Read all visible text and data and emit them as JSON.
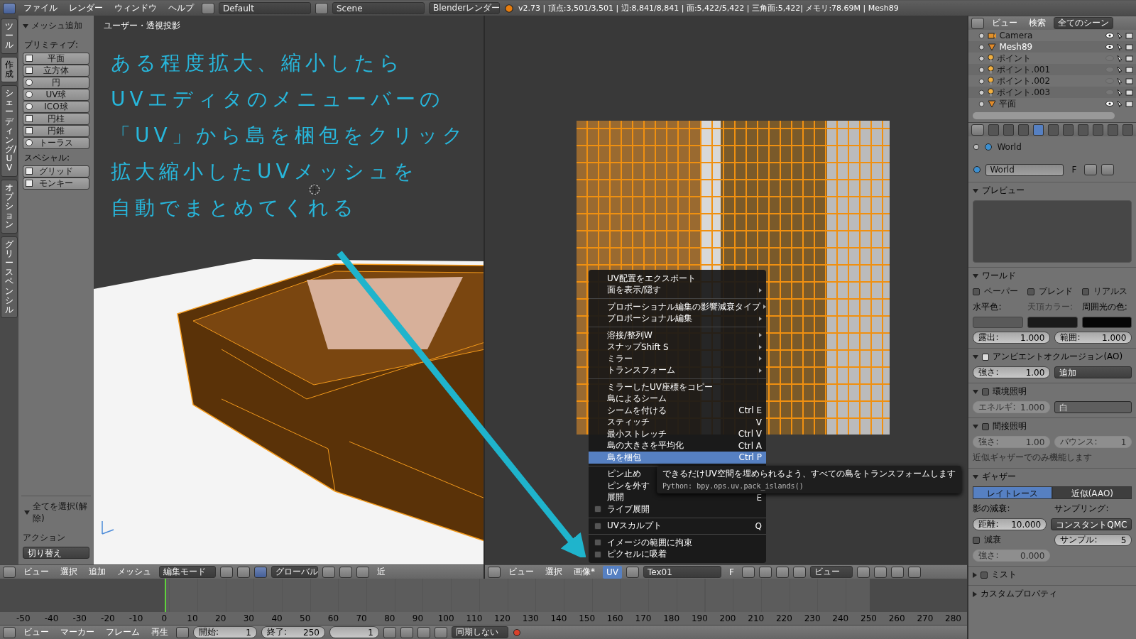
{
  "top_bar": {
    "menus": [
      "ファイル",
      "レンダー",
      "ウィンドウ",
      "ヘルプ"
    ],
    "screen_layout": "Default",
    "scene": "Scene",
    "render_engine": "Blenderレンダー",
    "stats": "v2.73 | 頂点:3,501/3,501 | 辺:8,841/8,841 | 面:5,422/5,422 | 三角面:5,422| メモリ:78.69M | Mesh89"
  },
  "tool_tabs": [
    {
      "label": "ツール",
      "selected": false
    },
    {
      "label": "作成",
      "selected": true
    },
    {
      "label": "シェーディング/UV",
      "selected": false
    },
    {
      "label": "オプション",
      "selected": false
    },
    {
      "label": "グリースペンシル",
      "selected": false
    }
  ],
  "tool_shelf": {
    "title": "メッシュ追加",
    "sections": [
      {
        "label": "プリミティブ:",
        "buttons": [
          {
            "label": "平面",
            "kind": "square"
          },
          {
            "label": "立方体",
            "kind": "square"
          },
          {
            "label": "円",
            "kind": "round"
          },
          {
            "label": "UV球",
            "kind": "round"
          },
          {
            "label": "ICO球",
            "kind": "round"
          },
          {
            "label": "円柱",
            "kind": "square"
          },
          {
            "label": "円錐",
            "kind": "square"
          },
          {
            "label": "トーラス",
            "kind": "round"
          }
        ]
      },
      {
        "label": "スペシャル:",
        "buttons": [
          {
            "label": "グリッド",
            "kind": "square"
          },
          {
            "label": "モンキー",
            "kind": "square"
          }
        ]
      }
    ]
  },
  "operator_panel": {
    "title": "全てを選択(解除)",
    "action_label": "アクション",
    "action_value": "切り替え"
  },
  "viewport": {
    "label": "ユーザー・透視投影",
    "annotation": [
      "ある程度拡大、縮小したら",
      "UVエディタのメニューバーの",
      "「UV」から島を梱包をクリック",
      "拡大縮小したUVメッシュを",
      "自動でまとめてくれる"
    ]
  },
  "viewport_header": {
    "menus": [
      "ビュー",
      "選択",
      "追加",
      "メッシュ"
    ],
    "mode": "編集モード",
    "orientation": "グローバル",
    "clipped": "近"
  },
  "uv_menu": {
    "groups": [
      [
        {
          "kind": "command",
          "label": "UV配置をエクスポート",
          "submenu": false,
          "selected": false
        },
        {
          "kind": "command",
          "label": "面を表示/隠す",
          "submenu": true,
          "selected": false
        }
      ],
      [
        {
          "kind": "command",
          "label": "プロポーショナル編集の影響減衰タイプ",
          "submenu": true,
          "selected": false
        },
        {
          "kind": "command",
          "label": "プロポーショナル編集",
          "submenu": true,
          "selected": false
        }
      ],
      [
        {
          "kind": "command",
          "label": "溶接/整列",
          "shortcut": "W",
          "submenu": true,
          "selected": false
        },
        {
          "kind": "command",
          "label": "スナップ",
          "shortcut": "Shift S",
          "submenu": true,
          "selected": false
        },
        {
          "kind": "command",
          "label": "ミラー",
          "submenu": true,
          "selected": false
        },
        {
          "kind": "command",
          "label": "トランスフォーム",
          "submenu": true,
          "selected": false
        }
      ],
      [
        {
          "kind": "command",
          "label": "ミラーしたUV座標をコピー",
          "submenu": false,
          "selected": false
        },
        {
          "kind": "command",
          "label": "島によるシーム",
          "submenu": false,
          "selected": false
        },
        {
          "kind": "command",
          "label": "シームを付ける",
          "shortcut": "Ctrl E",
          "submenu": false,
          "selected": false
        },
        {
          "kind": "command",
          "label": "スティッチ",
          "shortcut": "V",
          "submenu": false,
          "selected": false
        },
        {
          "kind": "command",
          "label": "最小ストレッチ",
          "shortcut": "Ctrl V",
          "submenu": false,
          "selected": false
        },
        {
          "kind": "command",
          "label": "島の大きさを平均化",
          "shortcut": "Ctrl A",
          "submenu": false,
          "selected": false
        },
        {
          "kind": "command",
          "label": "島を梱包",
          "shortcut": "Ctrl P",
          "submenu": false,
          "selected": true
        }
      ],
      [
        {
          "kind": "command",
          "label": "ピン止め",
          "submenu": false,
          "selected": false
        },
        {
          "kind": "command",
          "label": "ピンを外す",
          "submenu": false,
          "selected": false
        },
        {
          "kind": "command",
          "label": "展開",
          "shortcut": "E",
          "submenu": false,
          "selected": false
        },
        {
          "kind": "toggle",
          "label": "ライブ展開",
          "checked": false,
          "submenu": false,
          "selected": false
        }
      ],
      [
        {
          "kind": "toggle",
          "label": "UVスカルプト",
          "shortcut": "Q",
          "checked": false,
          "submenu": false,
          "selected": false
        }
      ],
      [
        {
          "kind": "toggle",
          "label": "イメージの範囲に拘束",
          "checked": false,
          "submenu": false,
          "selected": false
        },
        {
          "kind": "toggle",
          "label": "ピクセルに吸着",
          "checked": false,
          "submenu": false,
          "selected": false
        }
      ]
    ]
  },
  "tooltip": {
    "text": "できるだけUV空間を埋められるよう、すべての島をトランスフォームします",
    "python": "Python: bpy.ops.uv.pack_islands()"
  },
  "uv_header": {
    "menus": [
      {
        "label": "ビュー",
        "selected": false
      },
      {
        "label": "選択",
        "selected": false
      },
      {
        "label": "画像*",
        "selected": false
      },
      {
        "label": "UV",
        "selected": true
      }
    ],
    "image": "Tex01",
    "fake_user": "F",
    "view": "ビュー"
  },
  "timeline": {
    "ticks": [
      "-50",
      "-40",
      "-30",
      "-20",
      "-10",
      "0",
      "10",
      "20",
      "30",
      "40",
      "50",
      "60",
      "70",
      "80",
      "90",
      "100",
      "110",
      "120",
      "130",
      "140",
      "150",
      "160",
      "170",
      "180",
      "190",
      "200",
      "210",
      "220",
      "230",
      "240",
      "250",
      "260",
      "270",
      "280"
    ]
  },
  "timeline_header": {
    "menus": [
      "ビュー",
      "マーカー",
      "フレーム",
      "再生"
    ],
    "start_label": "開始:",
    "start": "1",
    "end_label": "終了:",
    "end": "250",
    "current": "1",
    "sync": "同期しない"
  },
  "outliner": {
    "view": "ビュー",
    "search": "検索",
    "filter": "全てのシーン",
    "items": [
      {
        "name": "Camera",
        "kind": "camera",
        "selected": false,
        "visible": true
      },
      {
        "name": "Mesh89",
        "kind": "mesh",
        "selected": true,
        "visible": true
      },
      {
        "name": "ポイント",
        "kind": "lamp",
        "selected": false,
        "visible": false
      },
      {
        "name": "ポイント.001",
        "kind": "lamp",
        "selected": false,
        "visible": false
      },
      {
        "name": "ポイント.002",
        "kind": "lamp",
        "selected": false,
        "visible": false
      },
      {
        "name": "ポイント.003",
        "kind": "lamp",
        "selected": false,
        "visible": false
      },
      {
        "name": "平面",
        "kind": "mesh",
        "selected": false,
        "visible": true
      }
    ]
  },
  "properties": {
    "tabs": [
      {
        "selected": false
      },
      {
        "selected": false
      },
      {
        "selected": false
      },
      {
        "selected": true
      },
      {
        "selected": false
      },
      {
        "selected": false
      },
      {
        "selected": false
      },
      {
        "selected": false
      },
      {
        "selected": false
      },
      {
        "selected": false
      }
    ],
    "breadcrumb": "World",
    "world_name": "World",
    "fake_user": "F",
    "panels": [
      {
        "title": "プレビュー",
        "expanded": true,
        "rows": [
          [
            {
              "kind": "preview"
            }
          ]
        ]
      },
      {
        "title": "ワールド",
        "expanded": true,
        "rows": [
          [
            {
              "kind": "check",
              "label": "ペーパー",
              "checked": false
            },
            {
              "kind": "check",
              "label": "ブレンド",
              "checked": false
            },
            {
              "kind": "check",
              "label": "リアルス",
              "checked": false
            }
          ],
          [
            {
              "kind": "label",
              "text": "水平色:",
              "disabled": false
            },
            {
              "kind": "label",
              "text": "天頂カラー:",
              "disabled": true
            },
            {
              "kind": "label",
              "text": "周囲光の色:",
              "disabled": false
            }
          ],
          [
            {
              "kind": "swatch",
              "color": "#5a5a5a"
            },
            {
              "kind": "swatch",
              "color": "#1a1a1a"
            },
            {
              "kind": "swatch",
              "color": "#050505"
            }
          ],
          [
            {
              "kind": "number",
              "label": "露出:",
              "value": "1.000",
              "disabled": false
            },
            {
              "kind": "number",
              "label": "範囲:",
              "value": "1.000",
              "disabled": false
            }
          ]
        ]
      },
      {
        "title": "アンビエントオクルージョン(AO)",
        "expanded": true,
        "checked": true,
        "rows": [
          [
            {
              "kind": "number",
              "label": "強さ:",
              "value": "1.00",
              "disabled": false
            },
            {
              "kind": "dropdown",
              "value": "追加",
              "disabled": false
            }
          ]
        ]
      },
      {
        "title": "環境照明",
        "expanded": true,
        "checked": false,
        "rows": [
          [
            {
              "kind": "number",
              "label": "エネルギ:",
              "value": "1.000",
              "disabled": true
            },
            {
              "kind": "dropdown",
              "value": "白",
              "disabled": true
            }
          ]
        ]
      },
      {
        "title": "間接照明",
        "expanded": true,
        "checked": false,
        "rows": [
          [
            {
              "kind": "number",
              "label": "強さ:",
              "value": "1.00",
              "disabled": true
            },
            {
              "kind": "number",
              "label": "バウンス:",
              "value": "1",
              "disabled": true
            }
          ],
          [
            {
              "kind": "note",
              "text": "近似ギャザーでのみ機能します"
            }
          ]
        ]
      },
      {
        "title": "ギャザー",
        "expanded": true,
        "rows": [
          [
            {
              "kind": "tab",
              "label": "レイトレース",
              "selected": true
            },
            {
              "kind": "tab",
              "label": "近似(AAO)",
              "selected": false
            }
          ],
          [
            {
              "kind": "label",
              "text": "影の減衰:",
              "disabled": false
            },
            {
              "kind": "label",
              "text": "サンプリング:",
              "disabled": false
            }
          ],
          [
            {
              "kind": "number",
              "label": "距離:",
              "value": "10.000",
              "disabled": false
            },
            {
              "kind": "dropdown",
              "value": "コンスタントQMC",
              "disabled": false
            }
          ],
          [
            {
              "kind": "check",
              "label": "減衰",
              "checked": false
            },
            {
              "kind": "number",
              "label": "サンプル:",
              "value": "5",
              "disabled": false
            }
          ],
          [
            {
              "kind": "number",
              "label": "強さ:",
              "value": "0.000",
              "disabled": true
            },
            {
              "kind": "empty"
            }
          ]
        ]
      },
      {
        "title": "ミスト",
        "expanded": false,
        "checked": false
      },
      {
        "title": "カスタムプロパティ",
        "expanded": false
      }
    ]
  }
}
